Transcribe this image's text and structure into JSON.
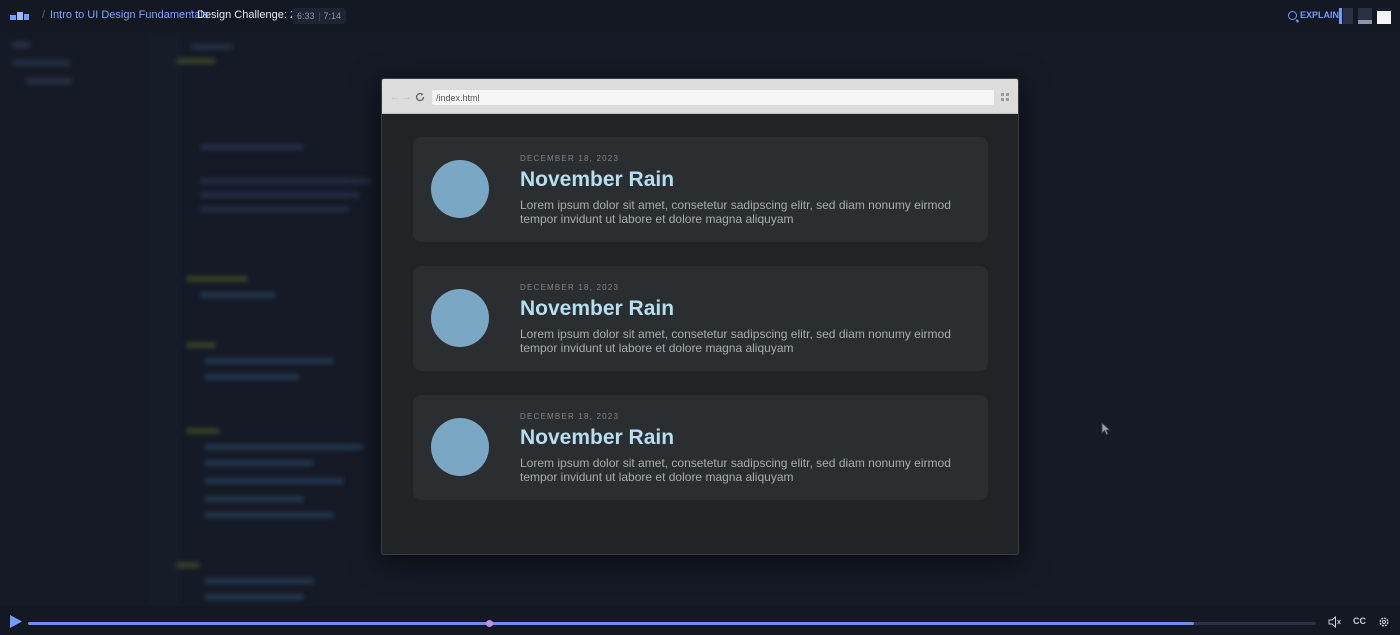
{
  "topbar": {
    "breadcrumb_sep": "/",
    "course": "Intro to UI Design Fundamentals",
    "lesson": "Design Challenge: 2",
    "time_current": "6:33",
    "time_total": "7:14",
    "explain_label": "EXPLAIN"
  },
  "browser": {
    "url": "/index.html",
    "back_glyph": "←",
    "forward_glyph": "→"
  },
  "cards": [
    {
      "date": "DECEMBER 18, 2023",
      "title": "November Rain",
      "text": "Lorem ipsum dolor sit amet, consetetur sadipscing elitr, sed diam nonumy eirmod tempor invidunt ut labore et dolore magna aliquyam"
    },
    {
      "date": "DECEMBER 18, 2023",
      "title": "November Rain",
      "text": "Lorem ipsum dolor sit amet, consetetur sadipscing elitr, sed diam nonumy eirmod tempor invidunt ut labore et dolore magna aliquyam"
    },
    {
      "date": "DECEMBER 18, 2023",
      "title": "November Rain",
      "text": "Lorem ipsum dolor sit amet, consetetur sadipscing elitr, sed diam nonumy eirmod tempor invidunt ut labore et dolore magna aliquyam"
    }
  ],
  "player": {
    "progress_fraction": 0.905,
    "marker_fraction": 0.358,
    "cc_label": "CC"
  },
  "colors": {
    "accent": "#6f9cff",
    "card_title": "#b6def0",
    "avatar": "#7aa7c4",
    "card_bg": "#2a2e30",
    "marker": "#c58df0"
  },
  "icons": {
    "logo": "scrimba-logo",
    "explain": "search-icon",
    "reload": "reload-icon",
    "menu": "grid-menu-icon",
    "play": "play-icon",
    "volume": "volume-icon",
    "settings": "gear-icon",
    "cursor": "mouse-cursor"
  }
}
